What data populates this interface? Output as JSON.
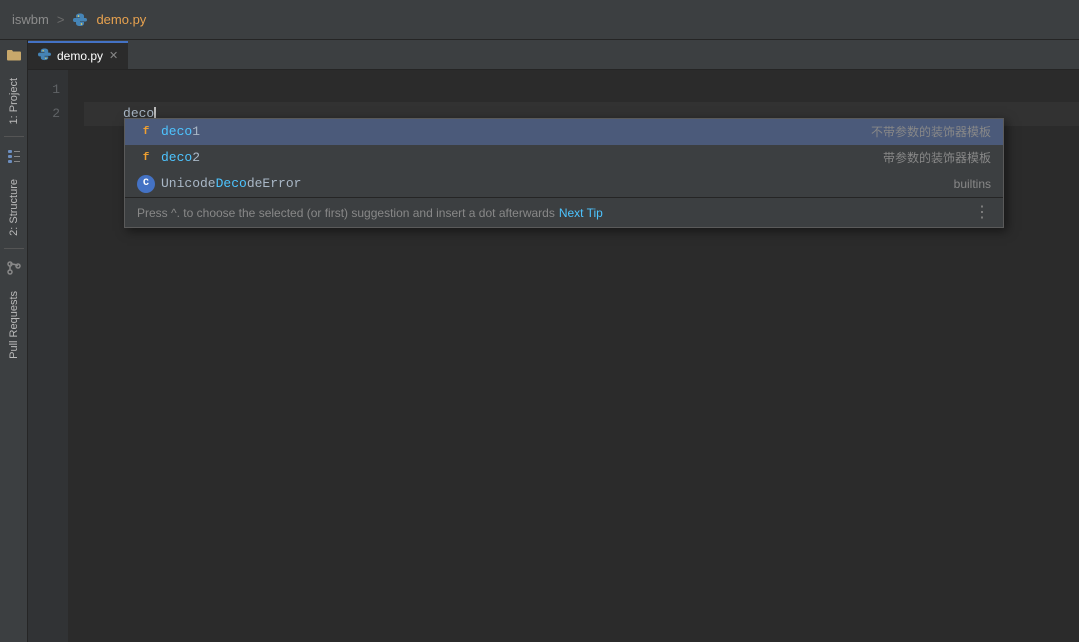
{
  "titleBar": {
    "project": "iswbm",
    "separator": ">",
    "file": "demo.py"
  },
  "tabs": [
    {
      "label": "demo.py",
      "active": true
    }
  ],
  "lineNumbers": [
    "1",
    "2"
  ],
  "codeLines": [
    {
      "content": "",
      "lineNum": 1
    },
    {
      "content": "deco",
      "lineNum": 2,
      "active": true
    }
  ],
  "autocomplete": {
    "items": [
      {
        "iconType": "orange",
        "iconLabel": "f",
        "namePrefix": "deco",
        "nameSuffix": "1",
        "description": "不带参数的装饰器模板"
      },
      {
        "iconType": "orange",
        "iconLabel": "f",
        "namePrefix": "deco",
        "nameSuffix": "2",
        "description": "带参数的装饰器模板"
      },
      {
        "iconType": "blue-circle",
        "iconLabel": "C",
        "namePrefix": "Unicode",
        "nameMatch": "Deco",
        "nameSuffix": "deError",
        "description": "builtins"
      }
    ],
    "tipText": "Press ^. to choose the selected (or first) suggestion and insert a dot afterwards",
    "nextTipLabel": "Next Tip",
    "moreLabel": "⋮"
  },
  "sidebar": {
    "projectLabel": "1: Project",
    "structureLabel": "2: Structure",
    "pullRequestsLabel": "Pull Requests"
  }
}
